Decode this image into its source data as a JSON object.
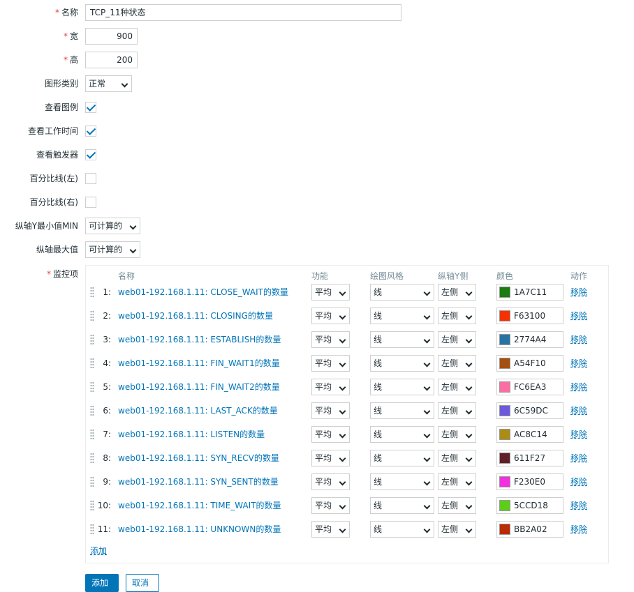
{
  "form": {
    "name": {
      "label": "名称",
      "value": "TCP_11种状态"
    },
    "width": {
      "label": "宽",
      "value": "900"
    },
    "height": {
      "label": "高",
      "value": "200"
    },
    "graph_type": {
      "label": "图形类别",
      "value": "正常"
    },
    "show_legend": {
      "label": "查看图例",
      "checked": true
    },
    "show_working_time": {
      "label": "查看工作时间",
      "checked": true
    },
    "show_triggers": {
      "label": "查看触发器",
      "checked": true
    },
    "percentile_left": {
      "label": "百分比线(左)",
      "checked": false
    },
    "percentile_right": {
      "label": "百分比线(右)",
      "checked": false
    },
    "y_min": {
      "label": "纵轴Y最小值MIN",
      "value": "可计算的"
    },
    "y_max": {
      "label": "纵轴最大值",
      "value": "可计算的"
    },
    "items_label": "监控项",
    "required_mark": "*"
  },
  "items_table": {
    "headers": {
      "name": "名称",
      "function": "功能",
      "draw_style": "绘图风格",
      "y_axis_side": "纵轴Y侧",
      "color": "颜色",
      "action": "动作"
    },
    "rows": [
      {
        "num": "1:",
        "name": "web01-192.168.1.11: CLOSE_WAIT的数量",
        "function": "平均",
        "draw_style": "线",
        "y_axis_side": "左侧",
        "color": "1A7C11",
        "color_hex": "#1A7C11",
        "action": "移除"
      },
      {
        "num": "2:",
        "name": "web01-192.168.1.11: CLOSING的数量",
        "function": "平均",
        "draw_style": "线",
        "y_axis_side": "左侧",
        "color": "F63100",
        "color_hex": "#F63100",
        "action": "移除"
      },
      {
        "num": "3:",
        "name": "web01-192.168.1.11: ESTABLISH的数量",
        "function": "平均",
        "draw_style": "线",
        "y_axis_side": "左侧",
        "color": "2774A4",
        "color_hex": "#2774A4",
        "action": "移除"
      },
      {
        "num": "4:",
        "name": "web01-192.168.1.11: FIN_WAIT1的数量",
        "function": "平均",
        "draw_style": "线",
        "y_axis_side": "左侧",
        "color": "A54F10",
        "color_hex": "#A54F10",
        "action": "移除"
      },
      {
        "num": "5:",
        "name": "web01-192.168.1.11: FIN_WAIT2的数量",
        "function": "平均",
        "draw_style": "线",
        "y_axis_side": "左侧",
        "color": "FC6EA3",
        "color_hex": "#FC6EA3",
        "action": "移除"
      },
      {
        "num": "6:",
        "name": "web01-192.168.1.11: LAST_ACK的数量",
        "function": "平均",
        "draw_style": "线",
        "y_axis_side": "左侧",
        "color": "6C59DC",
        "color_hex": "#6C59DC",
        "action": "移除"
      },
      {
        "num": "7:",
        "name": "web01-192.168.1.11: LISTEN的数量",
        "function": "平均",
        "draw_style": "线",
        "y_axis_side": "左侧",
        "color": "AC8C14",
        "color_hex": "#AC8C14",
        "action": "移除"
      },
      {
        "num": "8:",
        "name": "web01-192.168.1.11: SYN_RECV的数量",
        "function": "平均",
        "draw_style": "线",
        "y_axis_side": "左侧",
        "color": "611F27",
        "color_hex": "#611F27",
        "action": "移除"
      },
      {
        "num": "9:",
        "name": "web01-192.168.1.11: SYN_SENT的数量",
        "function": "平均",
        "draw_style": "线",
        "y_axis_side": "左侧",
        "color": "F230E0",
        "color_hex": "#F230E0",
        "action": "移除"
      },
      {
        "num": "10:",
        "name": "web01-192.168.1.11: TIME_WAIT的数量",
        "function": "平均",
        "draw_style": "线",
        "y_axis_side": "左侧",
        "color": "5CCD18",
        "color_hex": "#5CCD18",
        "action": "移除"
      },
      {
        "num": "11:",
        "name": "web01-192.168.1.11: UNKNOWN的数量",
        "function": "平均",
        "draw_style": "线",
        "y_axis_side": "左侧",
        "color": "BB2A02",
        "color_hex": "#BB2A02",
        "action": "移除"
      }
    ],
    "add_label": "添加"
  },
  "buttons": {
    "submit": "添加",
    "cancel": "取消"
  }
}
